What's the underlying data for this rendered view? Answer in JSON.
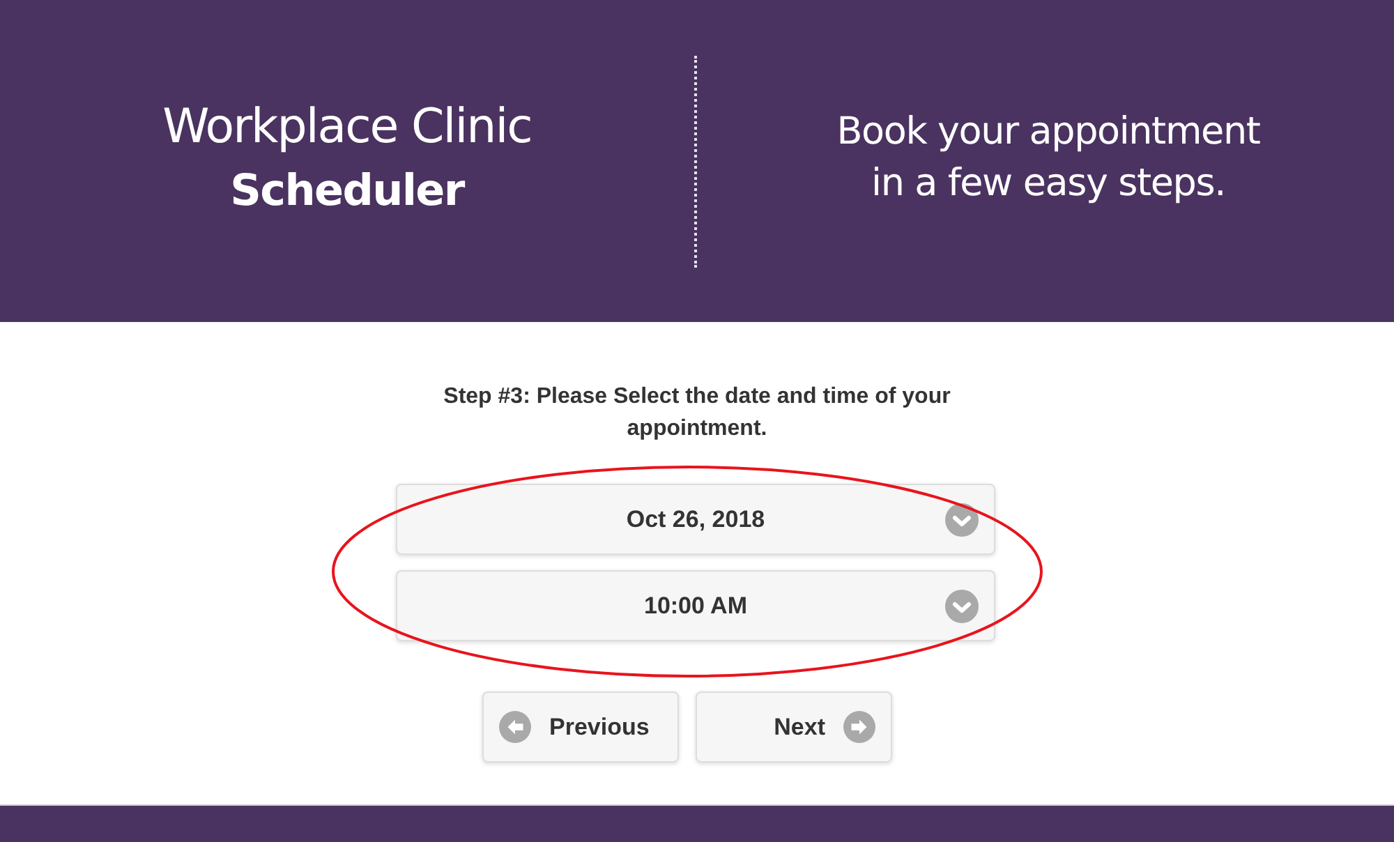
{
  "header": {
    "title_lines": [
      "Workplace Clinic",
      "Scheduler"
    ],
    "tagline_lines": [
      "Book your appointment",
      "in a few easy steps."
    ]
  },
  "step": {
    "instruction": "Step #3: Please Select the date and time of your appointment."
  },
  "selects": [
    {
      "value": "Oct 26, 2018"
    },
    {
      "value": "10:00 AM"
    }
  ],
  "buttons": [
    {
      "kind": "previous",
      "label": "Previous"
    },
    {
      "kind": "next",
      "label": "Next"
    }
  ]
}
